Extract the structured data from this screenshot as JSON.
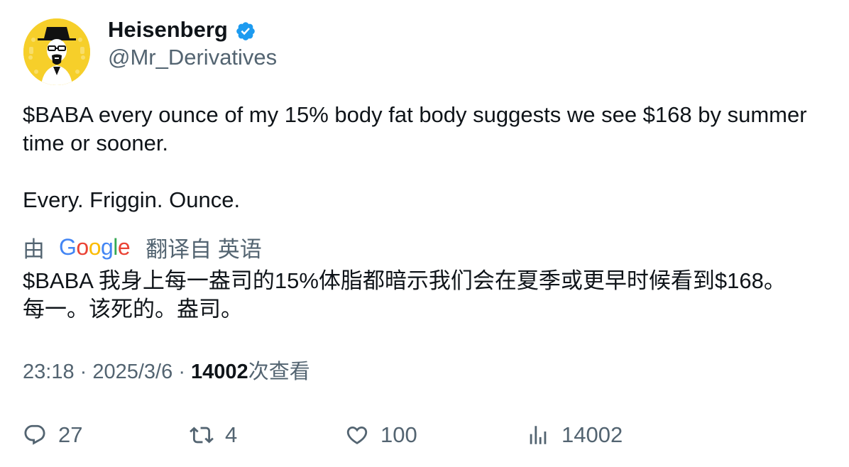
{
  "author": {
    "name": "Heisenberg",
    "handle": "@Mr_Derivatives"
  },
  "tweet": {
    "text": "$BABA every ounce of my 15% body fat body suggests we see $168 by summer time or sooner.\n\nEvery. Friggin. Ounce."
  },
  "translation": {
    "prefix": "由",
    "provider": "Google",
    "suffix": "翻译自 英语",
    "text": "$BABA 我身上每一盎司的15%体脂都暗示我们会在夏季或更早时候看到$168。\n每一。该死的。盎司。"
  },
  "meta": {
    "time": "23:18",
    "date": "2025/3/6",
    "views_count": "14002",
    "views_label": "次查看"
  },
  "actions": {
    "replies": "27",
    "retweets": "4",
    "likes": "100",
    "views": "14002"
  },
  "colors": {
    "verified": "#1d9bf0",
    "secondary_text": "#536471",
    "primary_text": "#0f1419",
    "avatar_bg": "#f6cf2a"
  }
}
